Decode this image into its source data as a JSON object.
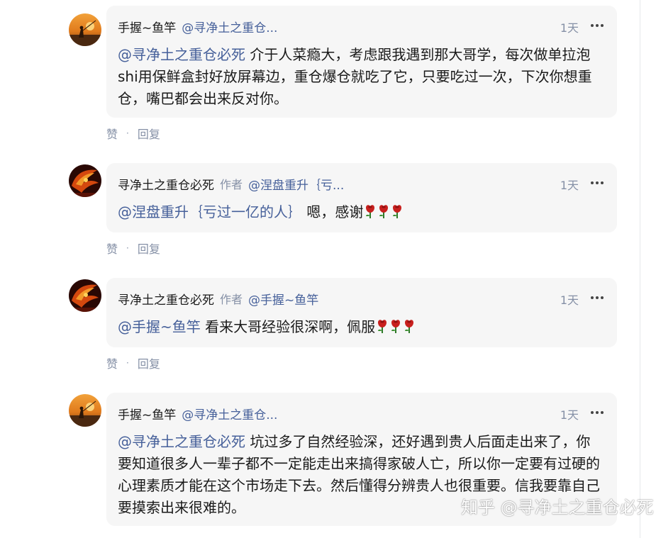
{
  "comments": [
    {
      "author": "手握~鱼竿",
      "tag": "",
      "reply_to": "@寻净土之重仓...",
      "time": "1天",
      "mention": "@寻净土之重仓必死",
      "text": " 介于人菜瘾大，考虑跟我遇到那大哥学，每次做单拉泡shi用保鲜盒封好放屏幕边，重仓爆仓就吃了它，只要吃过一次，下次你想重仓，嘴巴都会出来反对你。",
      "emoji": "",
      "like_label": "赞",
      "reply_label": "回复"
    },
    {
      "author": "寻净土之重仓必死",
      "tag": "作者",
      "reply_to": "@涅盘重升｛亏...",
      "time": "1天",
      "mention": "@涅盘重升｛亏过一亿的人｝",
      "text": " 嗯，感谢",
      "emoji": "rose-icon ×3",
      "like_label": "赞",
      "reply_label": "回复"
    },
    {
      "author": "寻净土之重仓必死",
      "tag": "作者",
      "reply_to": "@手握~鱼竿",
      "time": "1天",
      "mention": "@手握~鱼竿",
      "text": " 看来大哥经验很深啊，佩服",
      "emoji": "rose-icon ×3",
      "like_label": "赞",
      "reply_label": "回复"
    },
    {
      "author": "手握~鱼竿",
      "tag": "",
      "reply_to": "@寻净土之重仓...",
      "time": "1天",
      "mention": "@寻净土之重仓必死",
      "text": " 坑过多了自然经验深，还好遇到贵人后面走出来了，你要知道很多人一辈子都不一定能走出来搞得家破人亡，所以你一定要有过硬的心理素质才能在这个市场走下去。然后懂得分辨贵人也很重要。信我要靠自己要摸索出来很难的。",
      "emoji": "",
      "like_label": "赞",
      "reply_label": "回复"
    }
  ],
  "watermark": "知乎 @寻净土之重仓必死",
  "watermark_icon": "zhihu-logo",
  "colors": {
    "bubble_bg": "#f6f6f6",
    "mention": "#46609a",
    "meta": "#8590a6",
    "text": "#1a1a1a"
  }
}
